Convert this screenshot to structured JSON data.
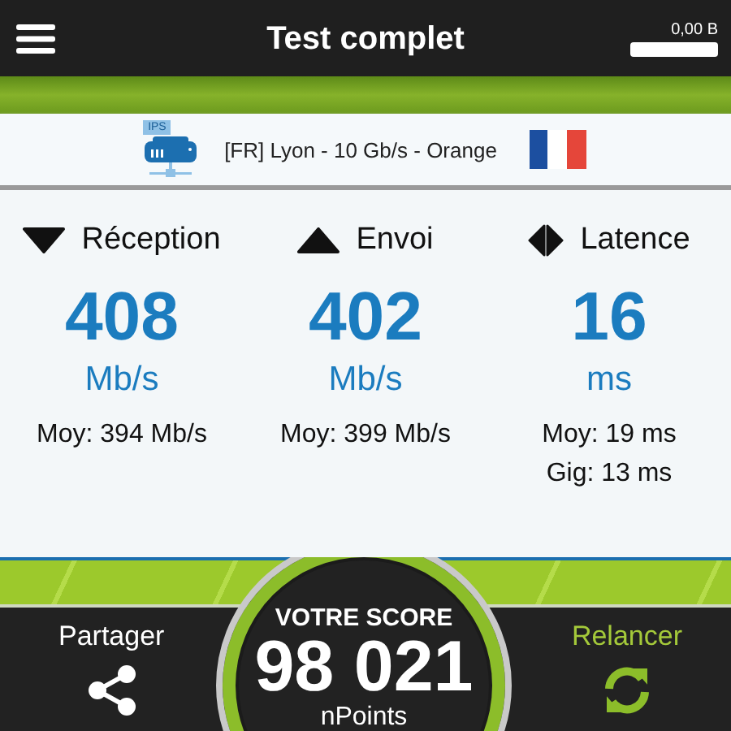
{
  "top_bar": {
    "title": "Test complet",
    "data_counter": "0,00 B"
  },
  "server": {
    "label": "[FR] Lyon - 10 Gb/s - Orange",
    "badge": "IPS"
  },
  "metrics": [
    {
      "kind": "download",
      "label": "Réception",
      "value": "408",
      "unit": "Mb/s",
      "stats": [
        "Moy: 394 Mb/s"
      ]
    },
    {
      "kind": "upload",
      "label": "Envoi",
      "value": "402",
      "unit": "Mb/s",
      "stats": [
        "Moy: 399 Mb/s"
      ]
    },
    {
      "kind": "latency",
      "label": "Latence",
      "value": "16",
      "unit": "ms",
      "stats": [
        "Moy: 19 ms",
        "Gig: 13 ms"
      ]
    }
  ],
  "footer": {
    "share_label": "Partager",
    "score_caption": "VOTRE SCORE",
    "score": "98 021",
    "score_unit": "nPoints",
    "retry_label": "Relancer"
  }
}
